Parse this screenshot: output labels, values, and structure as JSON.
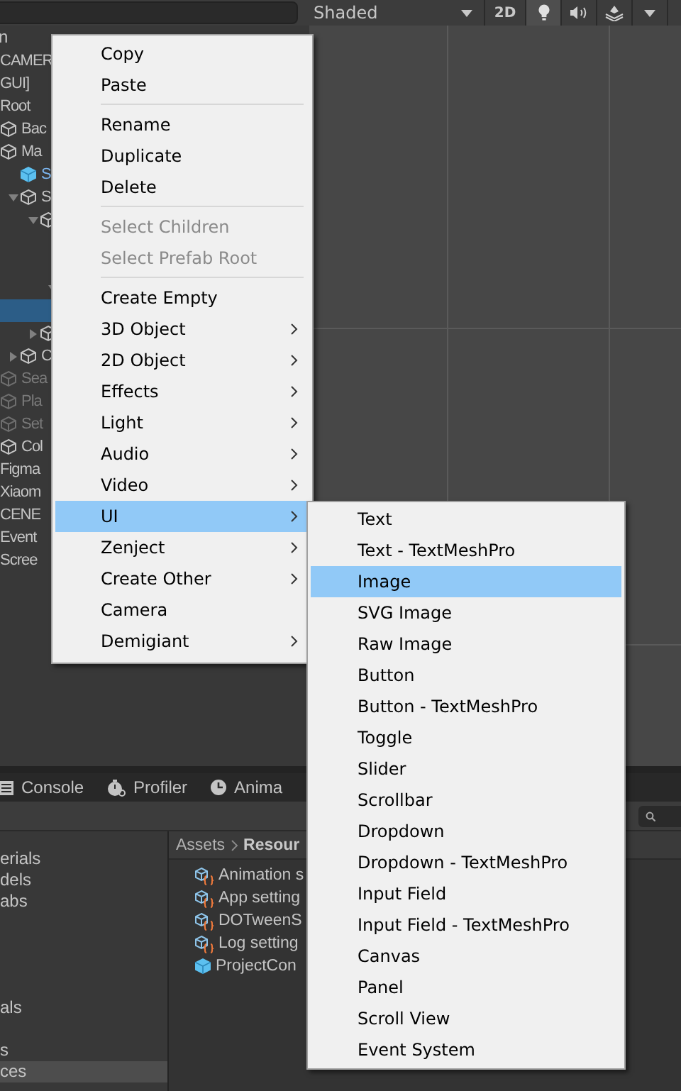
{
  "scene_toolbar": {
    "shading": "Shaded",
    "mode_2d": "2D",
    "lighting_on": true
  },
  "hierarchy": {
    "header": "n",
    "rows": [
      {
        "label": "CAMER",
        "kind": "label",
        "selected": false
      },
      {
        "label": "GUI]",
        "kind": "label",
        "selected": false
      },
      {
        "label": "Root",
        "kind": "label",
        "selected": false
      },
      {
        "label": "Bac",
        "kind": "gameobject",
        "selected": false
      },
      {
        "label": "Ma",
        "kind": "gameobject",
        "selected": false,
        "children": [
          {
            "label": "S",
            "kind": "prefab",
            "selected": false
          },
          {
            "label": "S",
            "kind": "gameobject",
            "selected": false,
            "expanded": true,
            "children": [
              {
                "kind": "gameobject",
                "selected": false,
                "expanded": true,
                "children": [
                  {
                    "selected": false
                  },
                  {
                    "selected": false
                  },
                  {
                    "selected": false,
                    "expanded": true,
                    "children": [
                      {
                        "selected": true
                      }
                    ]
                  }
                ]
              },
              {
                "kind": "gameobject",
                "selected": false,
                "expanded": false
              }
            ]
          },
          {
            "label": "C",
            "kind": "gameobject",
            "selected": false,
            "expanded": false
          }
        ]
      },
      {
        "label": "Sea",
        "kind": "gameobject",
        "selected": false,
        "dimmed": true
      },
      {
        "label": "Pla",
        "kind": "gameobject",
        "selected": false,
        "dimmed": true
      },
      {
        "label": "Set",
        "kind": "gameobject",
        "selected": false,
        "dimmed": true
      },
      {
        "label": "Col",
        "kind": "gameobject",
        "selected": false
      },
      {
        "label": "Figma",
        "kind": "label",
        "selected": false
      },
      {
        "label": "Xiaom",
        "kind": "label",
        "selected": false
      },
      {
        "label": "CENE",
        "kind": "label",
        "selected": false
      },
      {
        "label": "Event",
        "kind": "label",
        "selected": false
      },
      {
        "label": "Scree",
        "kind": "label",
        "selected": false
      }
    ]
  },
  "context_menu": {
    "items": [
      {
        "kind": "item",
        "label": "Copy"
      },
      {
        "kind": "item",
        "label": "Paste"
      },
      {
        "kind": "separator"
      },
      {
        "kind": "item",
        "label": "Rename"
      },
      {
        "kind": "item",
        "label": "Duplicate"
      },
      {
        "kind": "item",
        "label": "Delete"
      },
      {
        "kind": "separator"
      },
      {
        "kind": "item",
        "label": "Select Children",
        "disabled": true
      },
      {
        "kind": "item",
        "label": "Select Prefab Root",
        "disabled": true
      },
      {
        "kind": "separator"
      },
      {
        "kind": "item",
        "label": "Create Empty"
      },
      {
        "kind": "item",
        "label": "3D Object",
        "submenu": true
      },
      {
        "kind": "item",
        "label": "2D Object",
        "submenu": true
      },
      {
        "kind": "item",
        "label": "Effects",
        "submenu": true
      },
      {
        "kind": "item",
        "label": "Light",
        "submenu": true
      },
      {
        "kind": "item",
        "label": "Audio",
        "submenu": true
      },
      {
        "kind": "item",
        "label": "Video",
        "submenu": true
      },
      {
        "kind": "item",
        "label": "UI",
        "submenu": true,
        "selected": true
      },
      {
        "kind": "item",
        "label": "Zenject",
        "submenu": true
      },
      {
        "kind": "item",
        "label": "Create Other",
        "submenu": true
      },
      {
        "kind": "item",
        "label": "Camera"
      },
      {
        "kind": "item",
        "label": "Demigiant",
        "submenu": true
      }
    ]
  },
  "ui_submenu": {
    "items": [
      {
        "label": "Text",
        "selected": false
      },
      {
        "label": "Text - TextMeshPro",
        "selected": false
      },
      {
        "label": "Image",
        "selected": true
      },
      {
        "label": "SVG Image",
        "selected": false
      },
      {
        "label": "Raw Image",
        "selected": false
      },
      {
        "label": "Button",
        "selected": false
      },
      {
        "label": "Button - TextMeshPro",
        "selected": false
      },
      {
        "label": "Toggle",
        "selected": false
      },
      {
        "label": "Slider",
        "selected": false
      },
      {
        "label": "Scrollbar",
        "selected": false
      },
      {
        "label": "Dropdown",
        "selected": false
      },
      {
        "label": "Dropdown - TextMeshPro",
        "selected": false
      },
      {
        "label": "Input Field",
        "selected": false
      },
      {
        "label": "Input Field - TextMeshPro",
        "selected": false
      },
      {
        "label": "Canvas",
        "selected": false
      },
      {
        "label": "Panel",
        "selected": false
      },
      {
        "label": "Scroll View",
        "selected": false
      },
      {
        "label": "Event System",
        "selected": false
      }
    ]
  },
  "bottom_tabs": [
    {
      "label": "Console",
      "kind": "console"
    },
    {
      "label": "Profiler",
      "kind": "profiler"
    },
    {
      "label": "Anima",
      "kind": "animation"
    }
  ],
  "project_tree": {
    "rows": [
      {
        "label": "erials",
        "selected": false
      },
      {
        "label": "dels",
        "selected": false
      },
      {
        "label": "abs",
        "selected": false
      },
      {
        "selected": false
      },
      {
        "selected": false
      },
      {
        "selected": false
      },
      {
        "selected": false
      },
      {
        "label": "als",
        "selected": false
      },
      {
        "selected": false
      },
      {
        "label": "s",
        "selected": false
      },
      {
        "label": "ces",
        "selected": true
      }
    ]
  },
  "project_browser": {
    "breadcrumb": [
      {
        "label": "Assets"
      },
      {
        "label": "Resour"
      }
    ],
    "items": [
      {
        "label": "Animation s",
        "kind": "scriptable"
      },
      {
        "label": "App setting",
        "kind": "scriptable"
      },
      {
        "label": "DOTweenS",
        "kind": "scriptable"
      },
      {
        "label": "Log setting",
        "kind": "scriptable"
      },
      {
        "label": "ProjectCon",
        "kind": "prefab"
      }
    ]
  }
}
